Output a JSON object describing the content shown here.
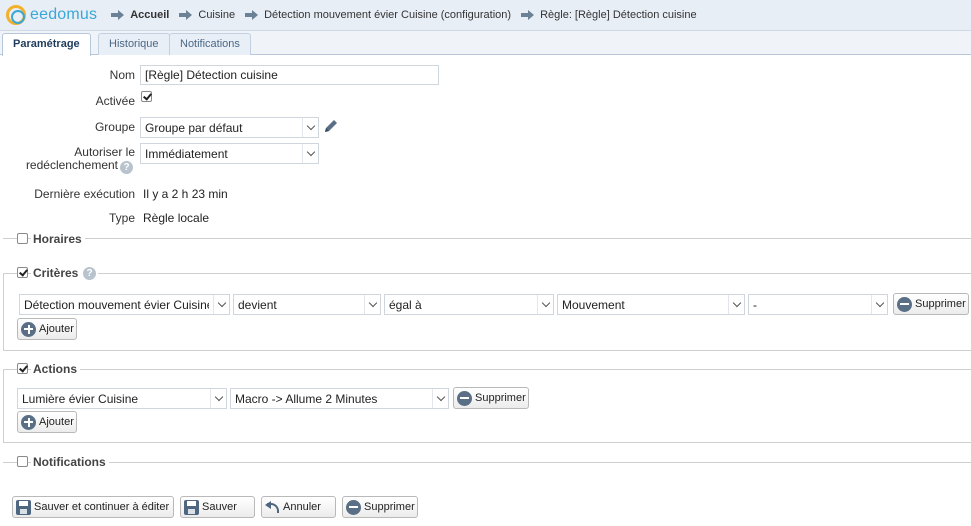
{
  "app": {
    "logo_text": "eedomus"
  },
  "breadcrumb": [
    {
      "label": "Accueil",
      "bold": true
    },
    {
      "label": "Cuisine"
    },
    {
      "label": "Détection mouvement évier Cuisine (configuration)"
    },
    {
      "label": "Règle: [Règle] Détection cuisine"
    }
  ],
  "tabs": [
    {
      "label": "Paramétrage",
      "active": true
    },
    {
      "label": "Historique"
    },
    {
      "label": "Notifications"
    }
  ],
  "form": {
    "nom_label": "Nom",
    "nom_value": "[Règle] Détection cuisine",
    "activee_label": "Activée",
    "activee_checked": true,
    "groupe_label": "Groupe",
    "groupe_value": "Groupe par défaut",
    "autoriser_label_line1": "Autoriser le",
    "autoriser_label_line2": "redéclenchement",
    "autoriser_value": "Immédiatement",
    "derniere_label": "Dernière exécution",
    "derniere_value": "Il y a 2 h 23 min",
    "type_label": "Type",
    "type_value": "Règle locale"
  },
  "horaires": {
    "legend": "Horaires",
    "checked": false
  },
  "criteres": {
    "legend": "Critères",
    "checked": true,
    "row": {
      "device": "Détection mouvement évier Cuisine",
      "condition": "devient",
      "operator": "égal à",
      "value": "Mouvement",
      "extra": "-"
    },
    "delete_label": "Supprimer",
    "add_label": "Ajouter"
  },
  "actions": {
    "legend": "Actions",
    "checked": true,
    "row": {
      "device": "Lumière évier Cuisine",
      "action": "Macro -> Allume 2 Minutes"
    },
    "delete_label": "Supprimer",
    "add_label": "Ajouter"
  },
  "notifications": {
    "legend": "Notifications",
    "checked": false
  },
  "footer": {
    "save_continue": "Sauver et continuer à éditer",
    "save": "Sauver",
    "cancel": "Annuler",
    "delete": "Supprimer"
  },
  "colors": {
    "accent": "#3aa7d6",
    "logo_ring": "#f3b12a",
    "topbar": "#e8eef6"
  }
}
